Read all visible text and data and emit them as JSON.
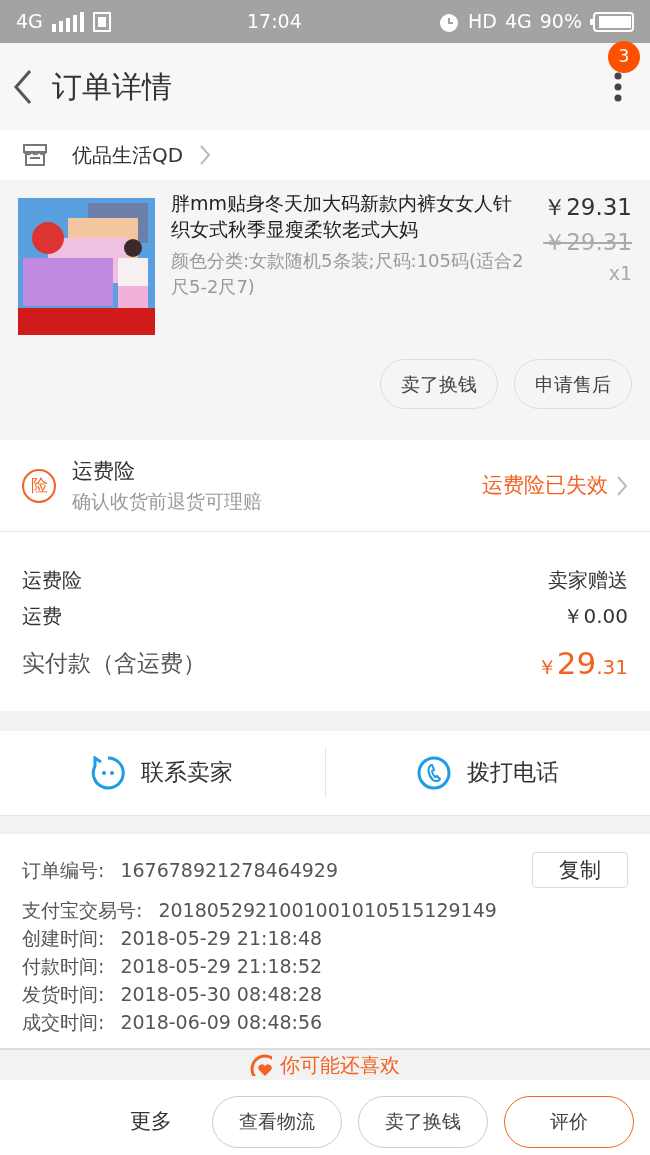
{
  "status_bar": {
    "network": "4G",
    "time": "17:04",
    "hd": "HD",
    "network_right": "4G",
    "battery": "90%"
  },
  "header": {
    "title": "订单详情",
    "badge": "3"
  },
  "shop": {
    "name": "优品生活QD"
  },
  "product": {
    "kind": "picture",
    "title": "胖mm贴身冬天加大码新款内裤女女人针织女式秋季显瘦柔软老式大妈",
    "sku": "颜色分类:女款随机5条装;尺码:105码(适合2尺5-2尺7)",
    "price": "￥29.31",
    "original_price": "￥29.31",
    "quantity": "x1",
    "buttons": [
      "卖了换钱",
      "申请售后"
    ]
  },
  "insurance": {
    "title": "运费险",
    "subtitle": "确认收货前退货可理赔",
    "status": "运费险已失效",
    "icon": "险"
  },
  "fees": [
    {
      "kind": "normal",
      "label": "运费险",
      "value": "卖家赠送"
    },
    {
      "kind": "normal",
      "label": "运费",
      "value": "￥0.00"
    },
    {
      "kind": "total",
      "label": "实付款（含运费）",
      "currency": "￥",
      "integer": "29",
      "decimal": ".31"
    }
  ],
  "contact": [
    {
      "kind": "chat",
      "label": "联系卖家"
    },
    {
      "kind": "phone",
      "label": "拨打电话"
    }
  ],
  "order_info": {
    "copy_button": "复制",
    "rows": [
      {
        "label": "订单编号:",
        "value": "167678921278464929"
      },
      {
        "label": "支付宝交易号:",
        "value": "2018052921001001010515129149"
      },
      {
        "label": "创建时间:",
        "value": "2018-05-29 21:18:48"
      },
      {
        "label": "付款时间:",
        "value": "2018-05-29 21:18:52"
      },
      {
        "label": "发货时间:",
        "value": "2018-05-30 08:48:28"
      },
      {
        "label": "成交时间:",
        "value": "2018-06-09 08:48:56"
      }
    ]
  },
  "recommend": {
    "title": "你可能还喜欢"
  },
  "bottom_bar": {
    "more": "更多",
    "buttons": [
      {
        "label": "查看物流",
        "kind": "outline"
      },
      {
        "label": "卖了换钱",
        "kind": "outline"
      },
      {
        "label": "评价",
        "kind": "accent"
      }
    ]
  }
}
